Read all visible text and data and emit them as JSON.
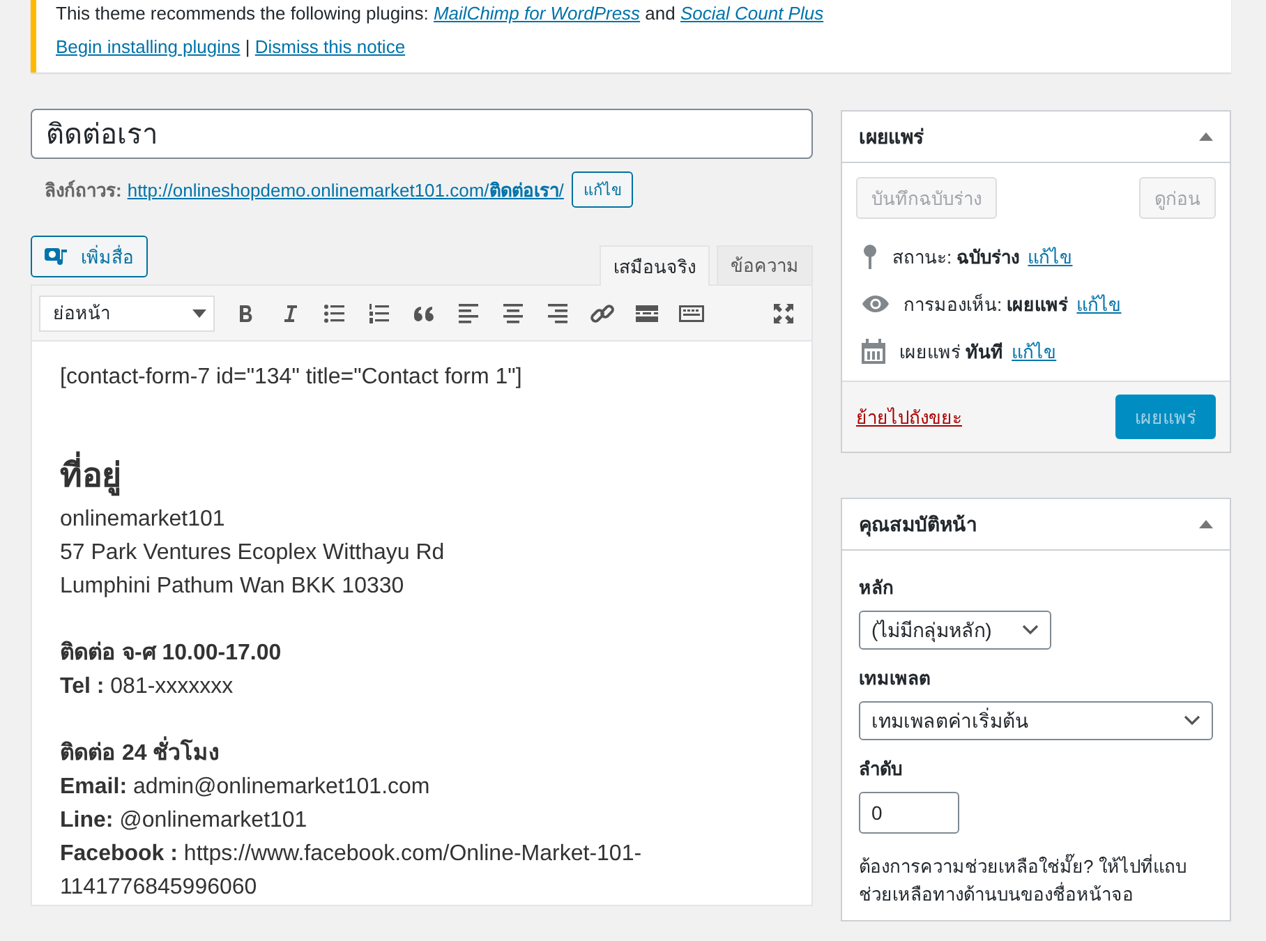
{
  "notice": {
    "text": "This theme recommends the following plugins: ",
    "plugins": [
      "MailChimp for WordPress",
      "Social Count Plus"
    ],
    "joiner": "and",
    "links": [
      "Begin installing plugins",
      "Dismiss this notice"
    ],
    "separator": "|"
  },
  "title": "ติดต่อเรา",
  "permalink": {
    "label": "ลิงก์ถาวร:",
    "url": "http://onlineshopdemo.onlinemarket101.com/",
    "slug": "ติดต่อเรา",
    "suffix": "/",
    "edit": "แก้ไข"
  },
  "add_media": "เพิ่มสื่อ",
  "tabs": [
    {
      "label": "เสมือนจริง",
      "selected": true
    },
    {
      "label": "ข้อความ",
      "selected": false
    }
  ],
  "format_select": "ย่อหน้า",
  "content": [
    {
      "kind": "line",
      "text": "[contact-form-7 id=\"134\" title=\"Contact form 1\"]",
      "bold": false
    },
    {
      "kind": "blank"
    },
    {
      "kind": "heading",
      "text": "ที่อยู่"
    },
    {
      "kind": "line",
      "text": "onlinemarket101",
      "bold": false
    },
    {
      "kind": "line",
      "text": "57 Park Ventures Ecoplex Witthayu Rd",
      "bold": false
    },
    {
      "kind": "line",
      "text": "Lumphini  Pathum Wan BKK 10330",
      "bold": false
    },
    {
      "kind": "blank"
    },
    {
      "kind": "line",
      "text": "ติดต่อ จ-ศ 10.00-17.00",
      "bold": true
    },
    {
      "kind": "line",
      "text": "**Tel :** 081-xxxxxxx",
      "bold": false
    },
    {
      "kind": "blank"
    },
    {
      "kind": "line",
      "text": "ติดต่อ 24 ชั่วโมง",
      "bold": true
    },
    {
      "kind": "line",
      "text": "**Email:** admin@onlinemarket101.com",
      "bold": false
    },
    {
      "kind": "line",
      "text": "**Line:** @onlinemarket101",
      "bold": false
    },
    {
      "kind": "line",
      "text": "**Facebook :** https://www.facebook.com/Online-Market-101-1141776845996060",
      "bold": false
    }
  ],
  "publish": {
    "title": "เผยแพร่",
    "save_draft": {
      "label": "บันทึกฉบับร่าง",
      "disabled": true
    },
    "preview": {
      "label": "ดูก่อน",
      "disabled": true
    },
    "rows": [
      {
        "kind": "pin",
        "label": "สถานะ:",
        "value": "ฉบับร่าง",
        "link": "แก้ไข"
      },
      {
        "kind": "eye",
        "label": "การมองเห็น:",
        "value": "เผยแพร่",
        "link": "แก้ไข"
      },
      {
        "kind": "calendar",
        "label": "เผยแพร่",
        "value": "ทันที",
        "link": "แก้ไข"
      }
    ],
    "trash": "ย้ายไปถังขยะ",
    "publish_button": {
      "label": "เผยแพร่",
      "disabled": true
    }
  },
  "page_attributes": {
    "title": "คุณสมบัติหน้า",
    "parent_label": "หลัก",
    "parent_value": "(ไม่มีกลุ่มหลัก)",
    "template_label": "เทมเพลต",
    "template_value": "เทมเพลตค่าเริ่มต้น",
    "order_label": "ลำดับ",
    "order_value": "0",
    "help": "ต้องการความช่วยเหลือใช่มั๊ย? ให้ไปที่แถบช่วยเหลือทางด้านบนของชื่อหน้าจอ"
  }
}
